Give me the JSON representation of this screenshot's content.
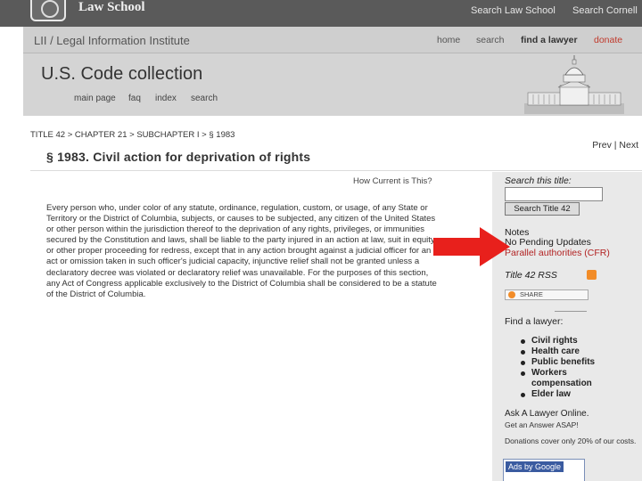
{
  "header": {
    "school_name": "Law School",
    "search_law_school": "Search Law School",
    "search_cornell": "Search Cornell"
  },
  "lii": {
    "title": "LII / Legal Information Institute",
    "nav": {
      "home": "home",
      "search": "search",
      "find_lawyer": "find a lawyer",
      "donate": "donate"
    }
  },
  "collection": {
    "title": "U.S. Code collection",
    "nav": {
      "main_page": "main page",
      "faq": "faq",
      "index": "index",
      "search": "search"
    }
  },
  "breadcrumb": "TITLE 42 > CHAPTER 21 > SUBCHAPTER I > § 1983",
  "prevnext": {
    "prev": "Prev",
    "sep": "|",
    "next": "Next"
  },
  "section": {
    "title": "§ 1983. Civil action for deprivation of rights",
    "how_current": "How Current is This?",
    "text": "Every person who, under color of any statute, ordinance, regulation, custom, or usage, of any State or Territory or the District of Columbia, subjects, or causes to be subjected, any citizen of the United States or other person within the jurisdiction thereof to the deprivation of any rights, privileges, or immunities secured by the Constitution and laws, shall be liable to the party injured in an action at law, suit in equity, or other proper proceeding for redress, except that in any action brought against a judicial officer for an act or omission taken in such officer's judicial capacity, injunctive relief shall not be granted unless a declaratory decree was violated or declaratory relief was unavailable. For the purposes of this section, any Act of Congress applicable exclusively to the District of Columbia shall be considered to be a statute of the District of Columbia."
  },
  "sidebar": {
    "search_label": "Search this title:",
    "search_button": "Search Title 42",
    "notes": "Notes",
    "pending_updates": "No Pending Updates",
    "parallel": "Parallel authorities (CFR)",
    "rss_label": "Title 42 RSS",
    "share": "SHARE",
    "find_lawyer": "Find a lawyer:",
    "lawyer_list": [
      "Civil rights",
      "Health care",
      "Public benefits",
      "Workers",
      "compensation",
      "Elder law"
    ],
    "ask_lawyer": "Ask A Lawyer Online.",
    "get_answer": "Get an Answer ASAP!",
    "donations": "Donations cover only 20% of our costs.",
    "ads_by": "Ads by Google"
  },
  "colors": {
    "header": "#5a5a5a",
    "lii_bar": "#cfcfcf",
    "sidebar": "#e9e9e9",
    "arrow": "#e8201c"
  }
}
